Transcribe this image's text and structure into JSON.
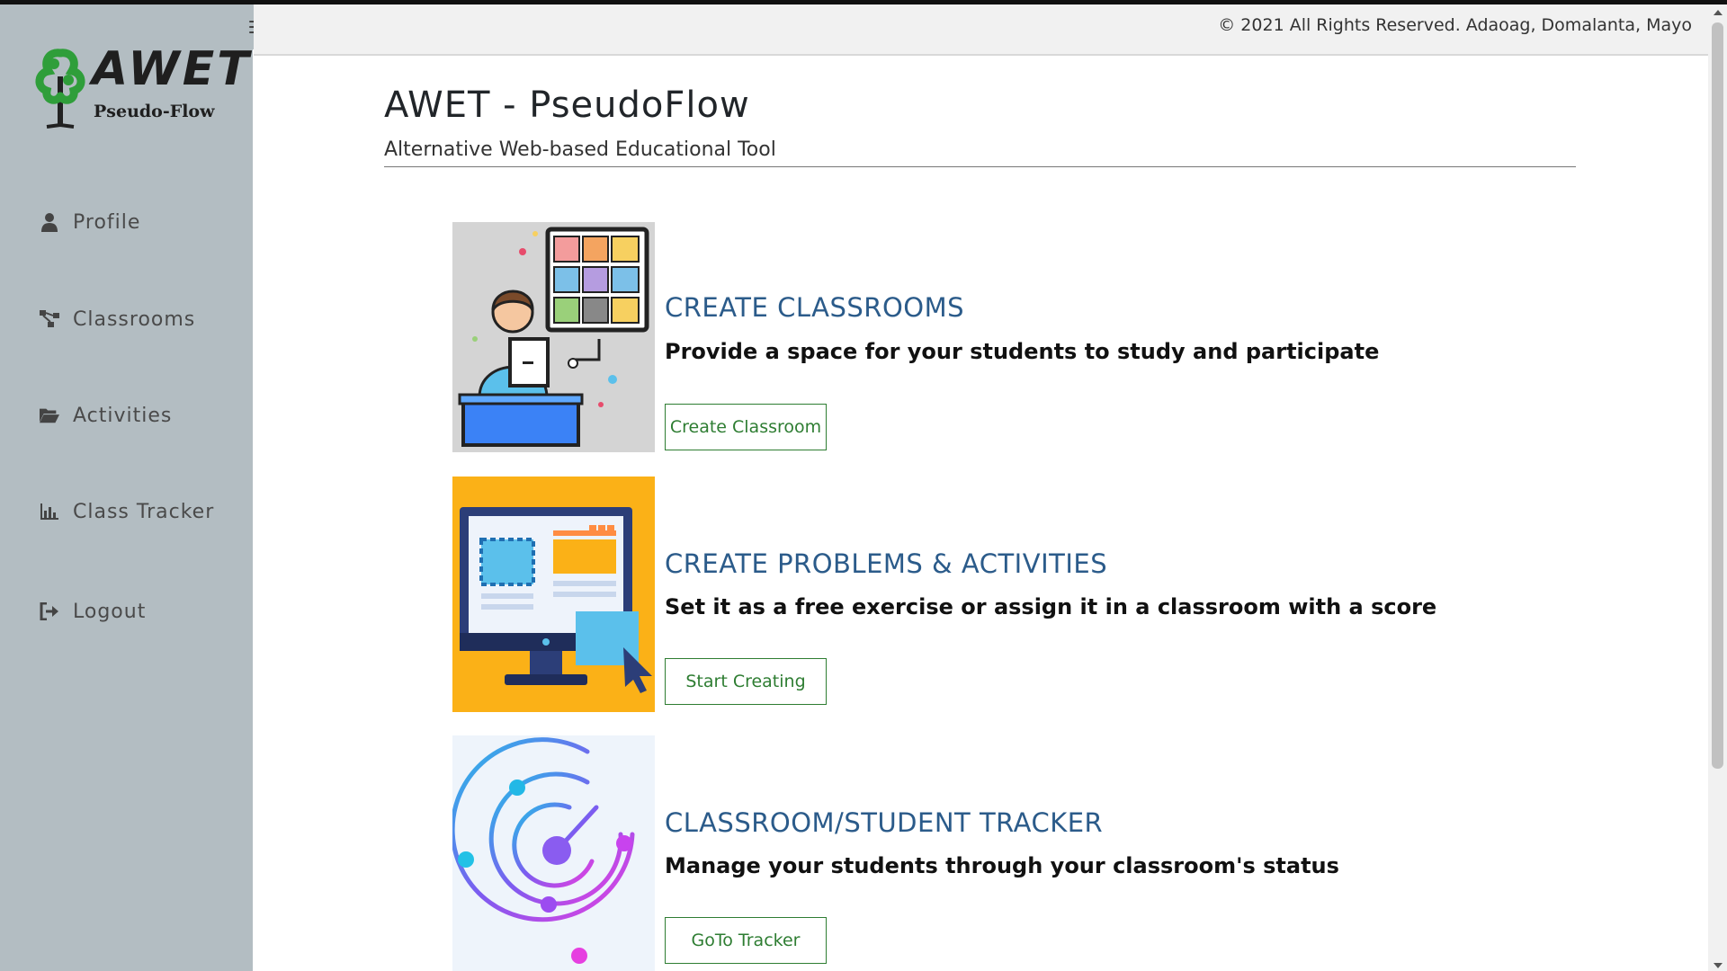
{
  "app": {
    "logo_title": "AWET",
    "logo_subtitle": "Pseudo-Flow"
  },
  "header": {
    "copyright": "© 2021 All Rights Reserved. Adaoag, Domalanta, Mayo"
  },
  "sidebar": {
    "items": [
      {
        "label": "Profile",
        "icon": "user-icon"
      },
      {
        "label": "Classrooms",
        "icon": "sitemap-icon"
      },
      {
        "label": "Activities",
        "icon": "folder-open-icon"
      },
      {
        "label": "Class Tracker",
        "icon": "bar-chart-icon"
      },
      {
        "label": "Logout",
        "icon": "sign-out-icon"
      }
    ]
  },
  "main": {
    "title": "AWET - PseudoFlow",
    "subtitle": "Alternative Web-based Educational Tool",
    "features": [
      {
        "heading": "CREATE CLASSROOMS",
        "description": "Provide a space for your students to study and participate",
        "button": "Create Classroom",
        "image": "online-class-illustration"
      },
      {
        "heading": "CREATE PROBLEMS & ACTIVITIES",
        "description": "Set it as a free exercise or assign it in a classroom with a score",
        "button": "Start Creating",
        "image": "monitor-design-illustration"
      },
      {
        "heading": "CLASSROOM/STUDENT TRACKER",
        "description": "Manage your students through your classroom's status",
        "button": "GoTo Tracker",
        "image": "tracker-orbit-illustration"
      }
    ]
  },
  "colors": {
    "sidebar_bg": "#b3bdc2",
    "heading": "#2b5b8a",
    "button_green": "#2e7d32",
    "logo_green": "#2f9e3a"
  }
}
